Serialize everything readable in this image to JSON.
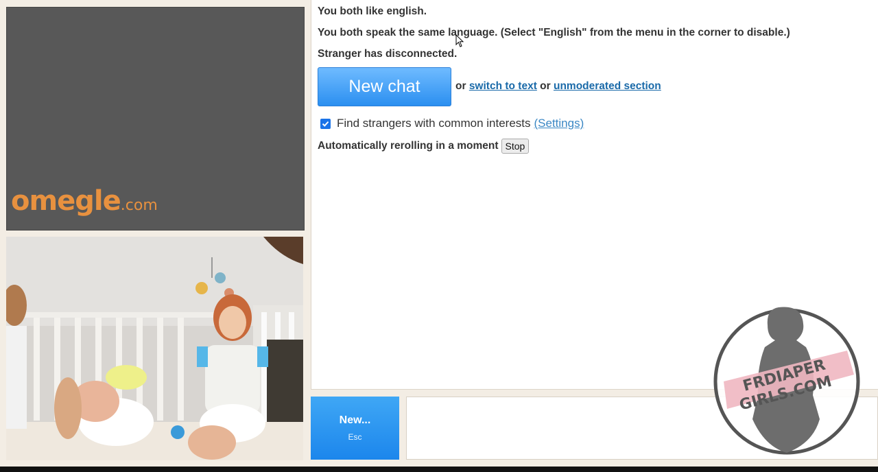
{
  "stranger_video": {
    "logo_main": "omegle",
    "logo_suffix": ".com"
  },
  "chat": {
    "line1": "You both like english.",
    "line2": "You both speak the same language. (Select \"English\" from the menu in the corner to disable.)",
    "line3": "Stranger has disconnected.",
    "new_chat_label": "New chat",
    "or1": "or",
    "switch_text": "switch to text",
    "or2": "or",
    "unmoderated": "unmoderated section",
    "interests_label": "Find strangers with common interests",
    "interests_checked": true,
    "settings_link": "(Settings)",
    "reroll_text": "Automatically rerolling in a moment",
    "stop_label": "Stop"
  },
  "bottom": {
    "new_label": "New...",
    "new_sub": "Esc",
    "message_value": ""
  },
  "watermark": {
    "line1": "FRDIAPER",
    "line2": "GIRLS.COM"
  },
  "colors": {
    "accent": "#2b8ff0",
    "logo": "#e8913f",
    "link": "#1a6aa9",
    "background": "#f3ede4"
  }
}
